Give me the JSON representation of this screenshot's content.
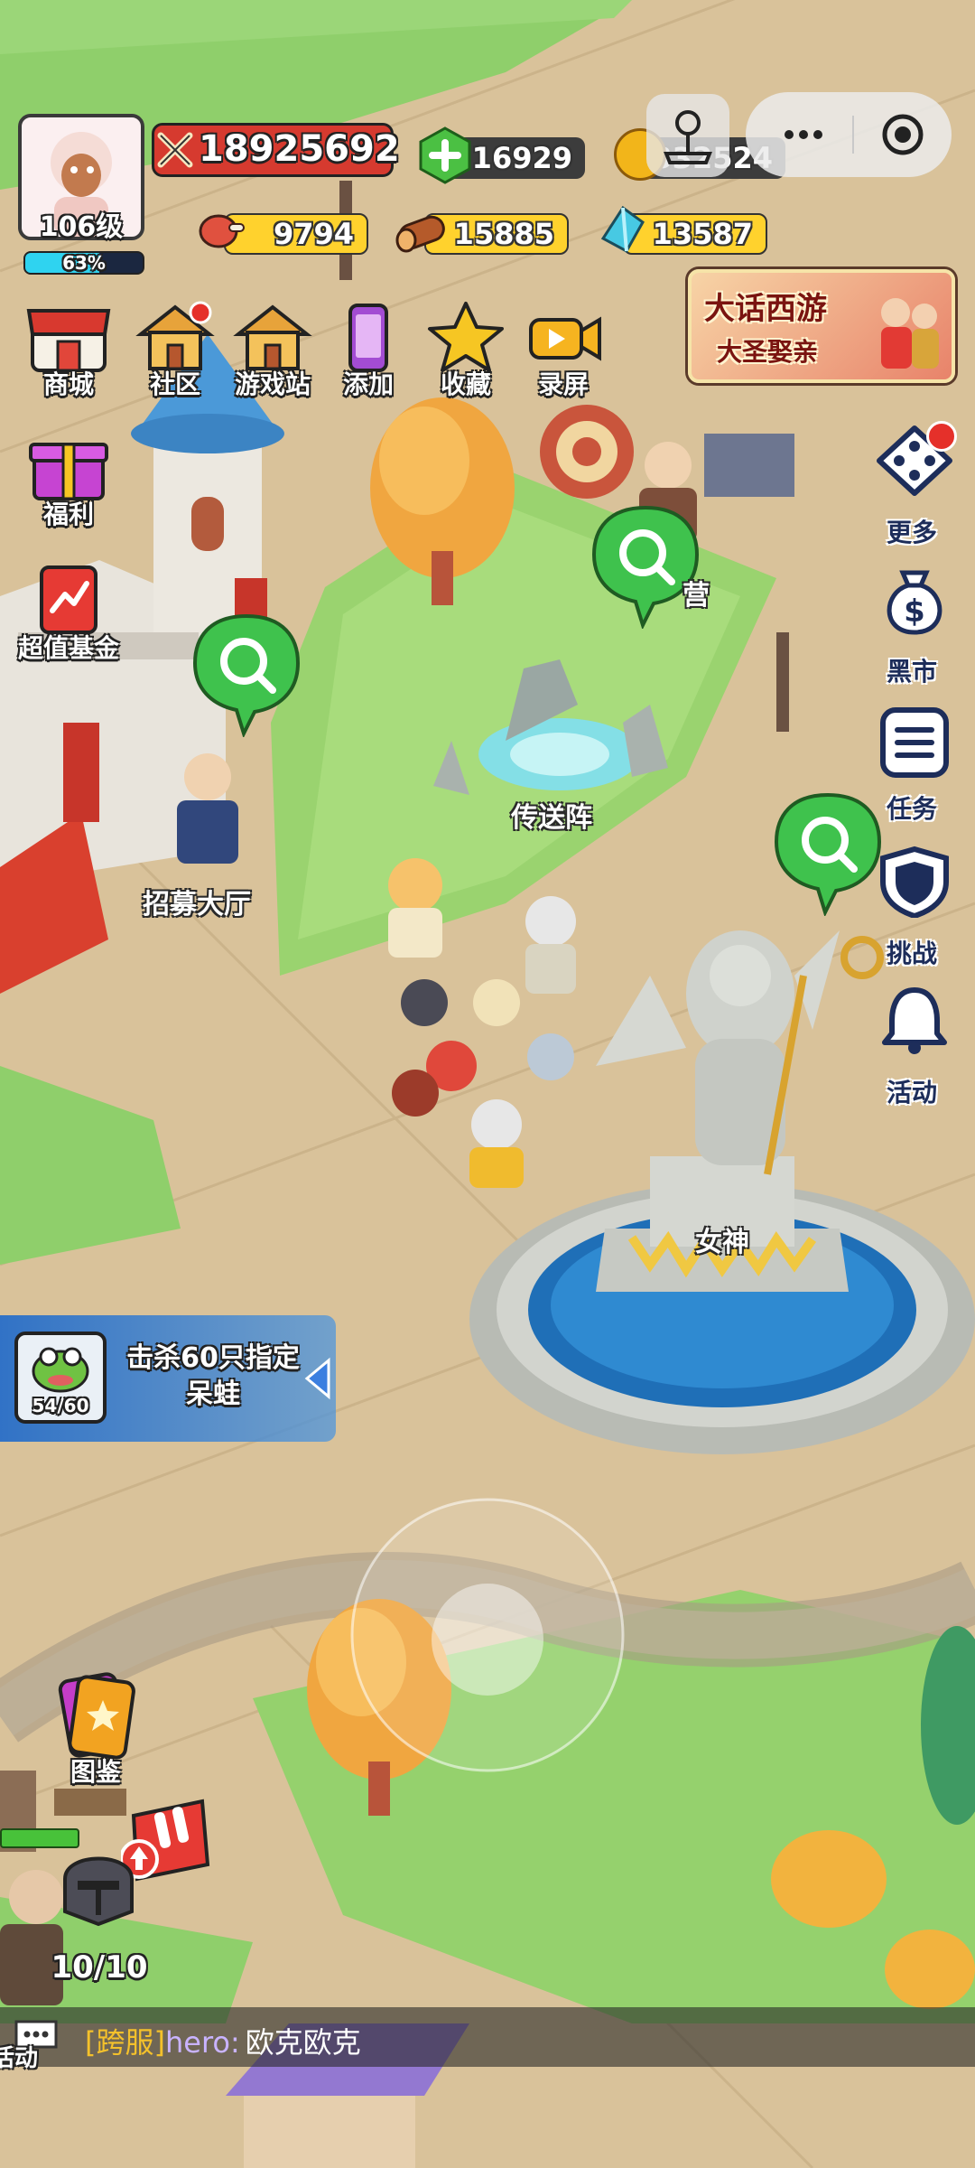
{
  "player": {
    "level": "106级",
    "exp_percent": 63,
    "exp_label": "63%",
    "power": "18925692"
  },
  "currencies": {
    "gem": "16929",
    "gold": "332524",
    "meat": "9794",
    "wood": "15885",
    "crystal": "13587"
  },
  "capsule": {
    "more_icon": "more-dots-icon",
    "close_icon": "target-close-icon"
  },
  "top_menu": [
    {
      "label": "商城",
      "icon": "shop-icon"
    },
    {
      "label": "社区",
      "icon": "community-house-icon"
    },
    {
      "label": "游戏站",
      "icon": "game-station-house-icon"
    },
    {
      "label": "添加",
      "icon": "phone-add-icon"
    },
    {
      "label": "收藏",
      "icon": "star-icon"
    },
    {
      "label": "录屏",
      "icon": "record-video-icon"
    }
  ],
  "left_menu": [
    {
      "label": "福利",
      "icon": "gift-icon"
    },
    {
      "label": "超值基金",
      "icon": "fund-icon"
    }
  ],
  "banner": {
    "title": "大话西游",
    "subtitle": "大圣娶亲"
  },
  "right_menu": [
    {
      "label": "更多",
      "icon": "dice-grid-icon"
    },
    {
      "label": "黑市",
      "icon": "money-bag-icon"
    },
    {
      "label": "任务",
      "icon": "task-list-icon"
    },
    {
      "label": "挑战",
      "icon": "shield-icon"
    },
    {
      "label": "活动",
      "icon": "bell-icon"
    }
  ],
  "world_labels": {
    "teleport": "传送阵",
    "recruit_hall": "招募大厅",
    "goddess": "女神",
    "partial_label": "营"
  },
  "quest": {
    "progress": "54/60",
    "text": "击杀60只指定呆蛙"
  },
  "bottom_left": {
    "codex": "图鉴",
    "squad_count": "10/10"
  },
  "chat": {
    "channel": "[跨服]",
    "sender": "hero:",
    "message": "欧克欧克",
    "cut_label": "活动"
  },
  "colors": {
    "gem_green": "#4bc043",
    "gold": "#f2b51a",
    "power_red": "#d63a2f",
    "bar_yellow": "#ffd22d",
    "speech_green": "#3fc24d",
    "exp_cyan": "#2fd3f0"
  }
}
